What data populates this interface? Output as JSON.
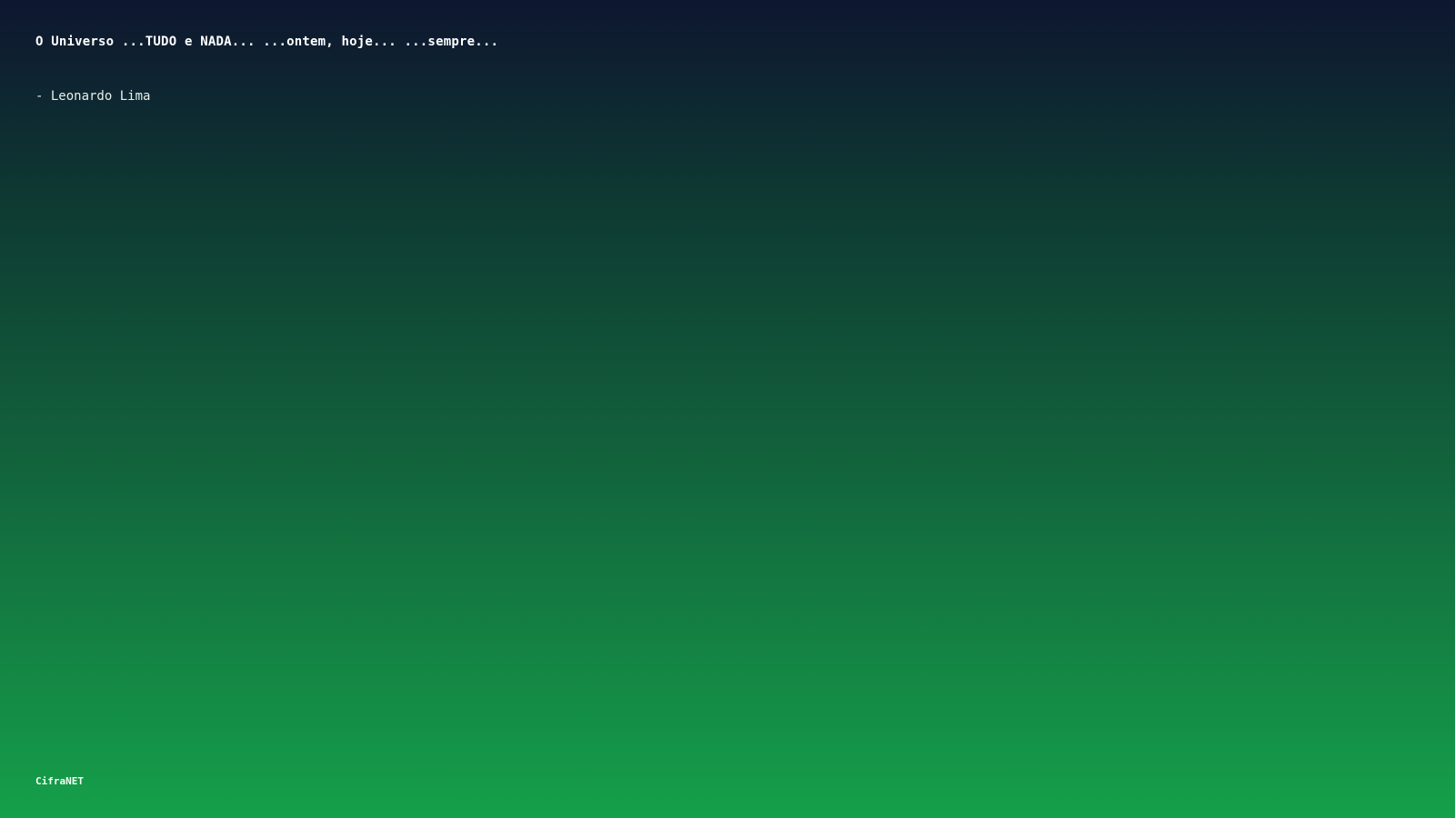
{
  "quote": {
    "text": "O Universo ...TUDO e NADA... ...ontem, hoje... ...sempre...",
    "author": "- Leonardo Lima"
  },
  "footer": {
    "brand": "CifraNET"
  },
  "colors": {
    "gradient_top": "#0e1630",
    "gradient_bottom": "#15a04a",
    "text": "#ffffff"
  }
}
